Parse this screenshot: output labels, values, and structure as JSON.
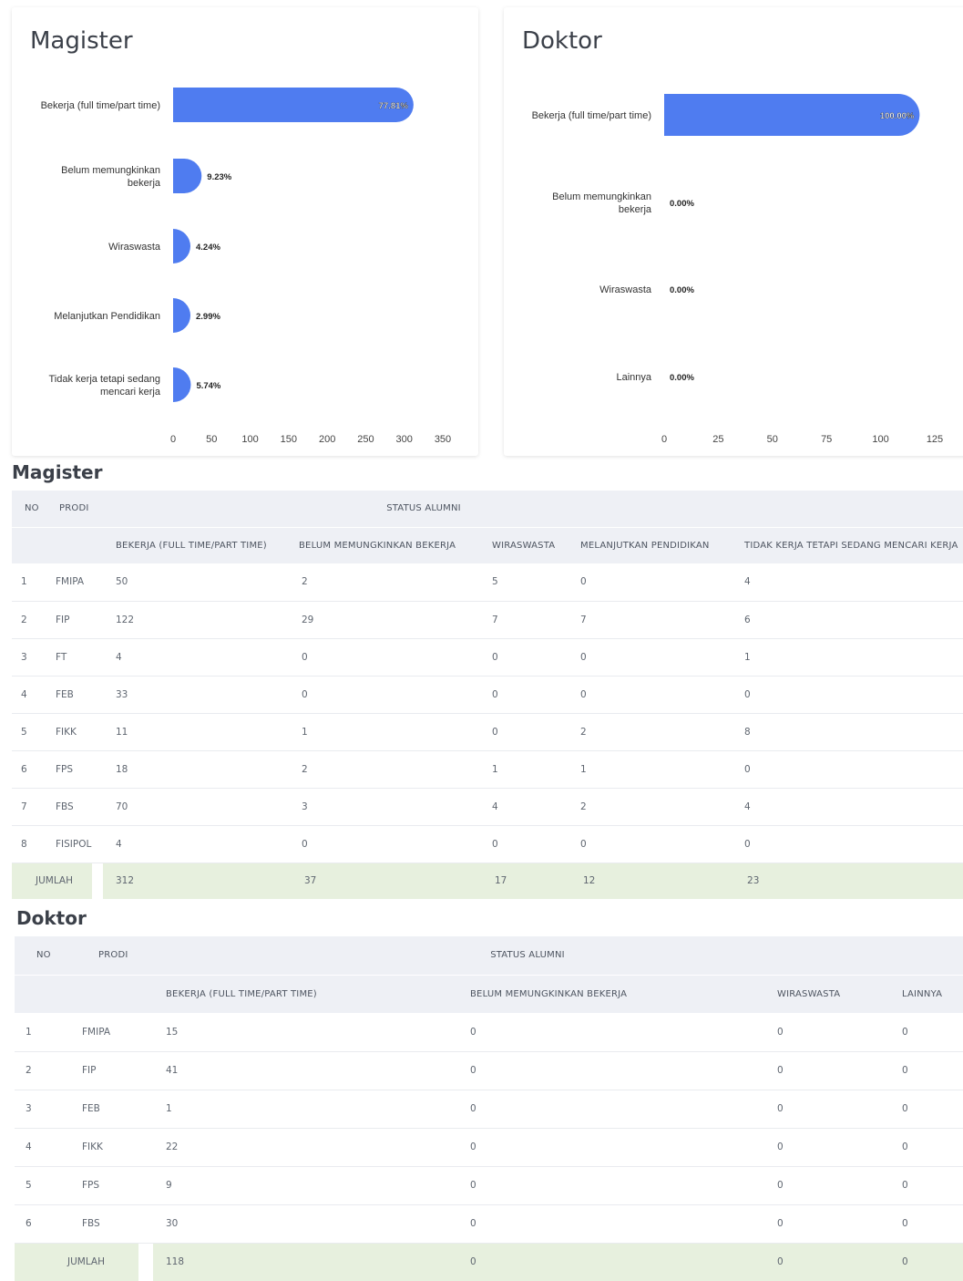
{
  "charts": {
    "magister": {
      "title": "Magister",
      "chart_data": {
        "type": "bar",
        "orientation": "horizontal",
        "categories": [
          "Bekerja (full time/part time)",
          "Belum memungkinkan bekerja",
          "Wiraswasta",
          "Melanjutkan Pendidikan",
          "Tidak kerja tetapi sedang mencari kerja"
        ],
        "values": [
          312,
          37,
          17,
          12,
          23
        ],
        "data_labels": [
          "77.81%",
          "9.23%",
          "4.24%",
          "2.99%",
          "5.74%"
        ],
        "xlim": [
          0,
          350
        ],
        "xticks": [
          "0",
          "50",
          "100",
          "150",
          "200",
          "250",
          "300",
          "350"
        ],
        "bar_color": "#4f7cf0",
        "grid": false
      }
    },
    "doktor": {
      "title": "Doktor",
      "chart_data": {
        "type": "bar",
        "orientation": "horizontal",
        "categories": [
          "Bekerja (full time/part time)",
          "Belum memungkinkan bekerja",
          "Wiraswasta",
          "Lainnya"
        ],
        "values": [
          118,
          0,
          0,
          0
        ],
        "data_labels": [
          "100.00%",
          "0.00%",
          "0.00%",
          "0.00%"
        ],
        "xlim": [
          0,
          125
        ],
        "xticks": [
          "0",
          "25",
          "50",
          "75",
          "100",
          "125"
        ],
        "bar_color": "#4f7cf0",
        "grid": false
      }
    }
  },
  "tables": {
    "magister": {
      "title": "Magister",
      "head_no": "NO",
      "head_prodi": "PRODI",
      "head_group": "STATUS ALUMNI",
      "columns": [
        "BEKERJA (FULL TIME/PART TIME)",
        "BELUM MEMUNGKINKAN BEKERJA",
        "WIRASWASTA",
        "MELANJUTKAN PENDIDIKAN",
        "TIDAK KERJA TETAPI SEDANG MENCARI KERJA"
      ],
      "rows": [
        [
          "1",
          "FMIPA",
          "50",
          "2",
          "5",
          "0",
          "4"
        ],
        [
          "2",
          "FIP",
          "122",
          "29",
          "7",
          "7",
          "6"
        ],
        [
          "3",
          "FT",
          "4",
          "0",
          "0",
          "0",
          "1"
        ],
        [
          "4",
          "FEB",
          "33",
          "0",
          "0",
          "0",
          "0"
        ],
        [
          "5",
          "FIKK",
          "11",
          "1",
          "0",
          "2",
          "8"
        ],
        [
          "6",
          "FPS",
          "18",
          "2",
          "1",
          "1",
          "0"
        ],
        [
          "7",
          "FBS",
          "70",
          "3",
          "4",
          "2",
          "4"
        ],
        [
          "8",
          "FISIPOL",
          "4",
          "0",
          "0",
          "0",
          "0"
        ]
      ],
      "total_label": "JUMLAH",
      "totals": [
        "312",
        "37",
        "17",
        "12",
        "23"
      ]
    },
    "doktor": {
      "title": "Doktor",
      "head_no": "NO",
      "head_prodi": "PRODI",
      "head_group": "STATUS ALUMNI",
      "columns": [
        "BEKERJA (FULL TIME/PART TIME)",
        "BELUM MEMUNGKINKAN BEKERJA",
        "WIRASWASTA",
        "LAINNYA"
      ],
      "rows": [
        [
          "1",
          "FMIPA",
          "15",
          "0",
          "0",
          "0"
        ],
        [
          "2",
          "FIP",
          "41",
          "0",
          "0",
          "0"
        ],
        [
          "3",
          "FEB",
          "1",
          "0",
          "0",
          "0"
        ],
        [
          "4",
          "FIKK",
          "22",
          "0",
          "0",
          "0"
        ],
        [
          "5",
          "FPS",
          "9",
          "0",
          "0",
          "0"
        ],
        [
          "6",
          "FBS",
          "30",
          "0",
          "0",
          "0"
        ]
      ],
      "total_label": "JUMLAH",
      "totals": [
        "118",
        "0",
        "0",
        "0"
      ]
    }
  }
}
